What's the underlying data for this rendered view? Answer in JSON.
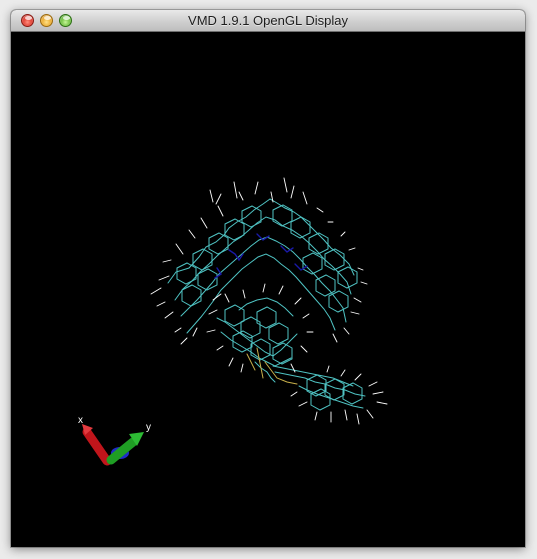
{
  "window": {
    "title": "VMD 1.9.1 OpenGL Display",
    "controls": [
      "close",
      "minimize",
      "zoom"
    ]
  },
  "display": {
    "background": "#000000",
    "molecule_colors": {
      "carbon_bonds": "#4fc3c3",
      "hydrogen_bonds": "#ffffff",
      "nitrogen_bonds": "#1a1aa8",
      "sulfur_bonds": "#c8b04a"
    },
    "axes": {
      "x_label": "x",
      "y_label": "y",
      "x_color": "#c0151b",
      "y_color": "#1f9e24",
      "z_color": "#1f2bc8"
    }
  }
}
